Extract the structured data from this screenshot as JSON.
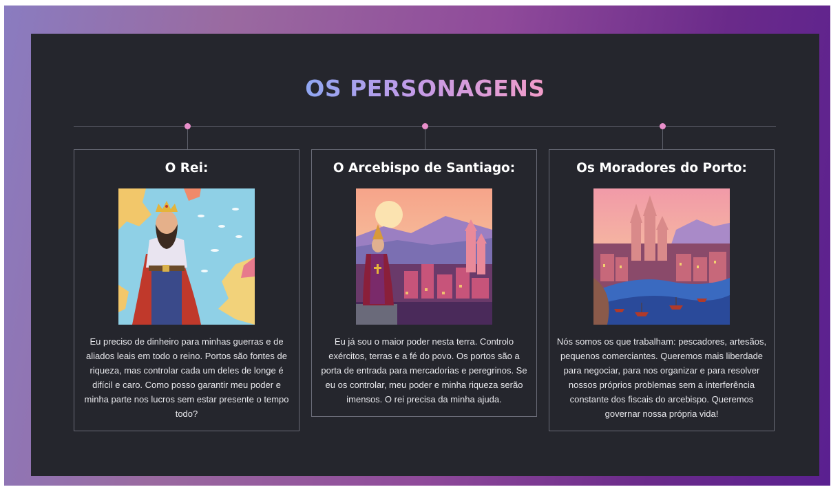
{
  "title": "OS PERSONAGENS",
  "colors": {
    "slide_background": "#25262d",
    "timeline_dot": "#e98fcb",
    "title_gradient": [
      "#8fa6f2",
      "#c39be8",
      "#f29cc8"
    ]
  },
  "cards": [
    {
      "heading": "O Rei:",
      "image": "king-illustration",
      "text": "Eu preciso de dinheiro para minhas guerras e de aliados leais em todo o reino. Portos são fontes de riqueza, mas controlar cada um deles de longe é difícil e caro. Como posso garantir meu poder e minha parte nos lucros sem estar presente o tempo todo?"
    },
    {
      "heading": "O Arcebispo de Santiago:",
      "image": "archbishop-illustration",
      "text": "Eu já sou o maior poder nesta terra. Controlo exércitos, terras e a fé do povo. Os portos são a porta de entrada para mercadorias e peregrinos. Se eu os controlar, meu poder e minha riqueza serão imensos. O rei precisa da minha ajuda."
    },
    {
      "heading": "Os Moradores do Porto:",
      "image": "port-town-illustration",
      "text": "Nós somos os que trabalham: pescadores, artesãos, pequenos comerciantes. Queremos mais liberdade para negociar, para nos organizar e para resolver nossos próprios problemas sem a interferência constante dos fiscais do arcebispo. Queremos governar nossa própria vida!"
    }
  ]
}
